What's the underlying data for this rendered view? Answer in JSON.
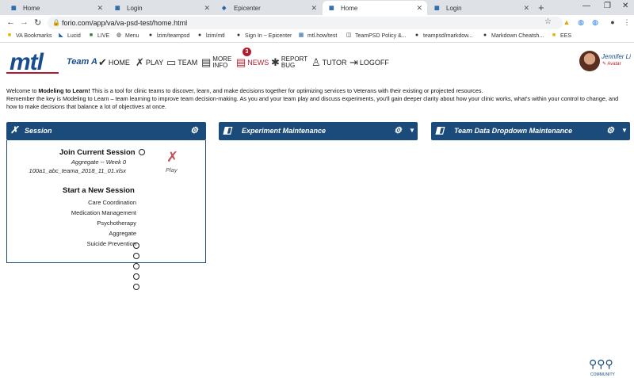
{
  "browser": {
    "tabs": [
      {
        "title": "Home",
        "active": false
      },
      {
        "title": "Login",
        "active": false
      },
      {
        "title": "Epicenter",
        "active": false
      },
      {
        "title": "Home",
        "active": true
      },
      {
        "title": "Login",
        "active": false
      }
    ],
    "url": "forio.com/app/va/va-psd-test/home.html",
    "bookmarks": [
      {
        "label": "VA Bookmarks",
        "icon": "folder-icon"
      },
      {
        "label": "Lucid",
        "icon": "lucid-icon"
      },
      {
        "label": "LIVE",
        "icon": "live-icon"
      },
      {
        "label": "Menu",
        "icon": "globe-icon"
      },
      {
        "label": "lzim/teampsd",
        "icon": "github-icon"
      },
      {
        "label": "lzim/mtl",
        "icon": "github-icon"
      },
      {
        "label": "Sign In ~ Epicenter",
        "icon": "github-icon"
      },
      {
        "label": "mtl.how/test",
        "icon": "mtl-icon"
      },
      {
        "label": "TeamPSD Policy &...",
        "icon": "doc-icon"
      },
      {
        "label": "teampsd/markdow...",
        "icon": "github-icon"
      },
      {
        "label": "Markdown Cheatsh...",
        "icon": "github-icon"
      },
      {
        "label": "EES",
        "icon": "folder-icon"
      }
    ]
  },
  "header": {
    "logo": "mtl",
    "team": "Team A",
    "nav": [
      {
        "label": "HOME",
        "icon": "check-icon"
      },
      {
        "label": "PLAY",
        "icon": "play-icon"
      },
      {
        "label": "TEAM",
        "icon": "team-icon"
      },
      {
        "label": "MORE\nINFO",
        "icon": "book-icon"
      },
      {
        "label": "NEWS",
        "icon": "news-icon",
        "badge": "3"
      },
      {
        "label": "REPORT\nBUG",
        "icon": "bug-icon"
      },
      {
        "label": "TUTOR",
        "icon": "tutor-icon"
      },
      {
        "label": "LOGOFF",
        "icon": "logoff-icon"
      }
    ],
    "user": {
      "name": "Jennifer Li",
      "avatar_link": "Avatar"
    }
  },
  "welcome": {
    "intro": "Welcome to ",
    "app_name": "Modeling to Learn!",
    "line1_rest": " This is a tool for clinic teams to discover, learn, and make decisions together for optimizing services to Veterans with their existing or projected resources.",
    "line2": "Remember the key is Modeling to Learn – team learning to improve team decision-making. As you and your team play and discuss experiments, you'll gain deeper clarity about how your clinic works, what's within your control to change, and how to make decisions that balance a lot of objectives at once."
  },
  "panels": {
    "session": {
      "title": "Session"
    },
    "experiment": {
      "title": "Experiment Maintenance"
    },
    "team_data": {
      "title": "Team Data Dropdown Maintenance"
    }
  },
  "session": {
    "join_title": "Join Current Session",
    "join_line1": "Aggregate -- Week 0",
    "join_line2": "100a1_abc_teama_2018_11_01.xlsx",
    "play_label": "Play",
    "start_title": "Start a New Session",
    "options": [
      "Care Coordination",
      "Medication Management",
      "Psychotherapy",
      "Aggregate",
      "Suicide Prevention"
    ]
  },
  "footer": {
    "community_label": "COMMUNITY"
  }
}
